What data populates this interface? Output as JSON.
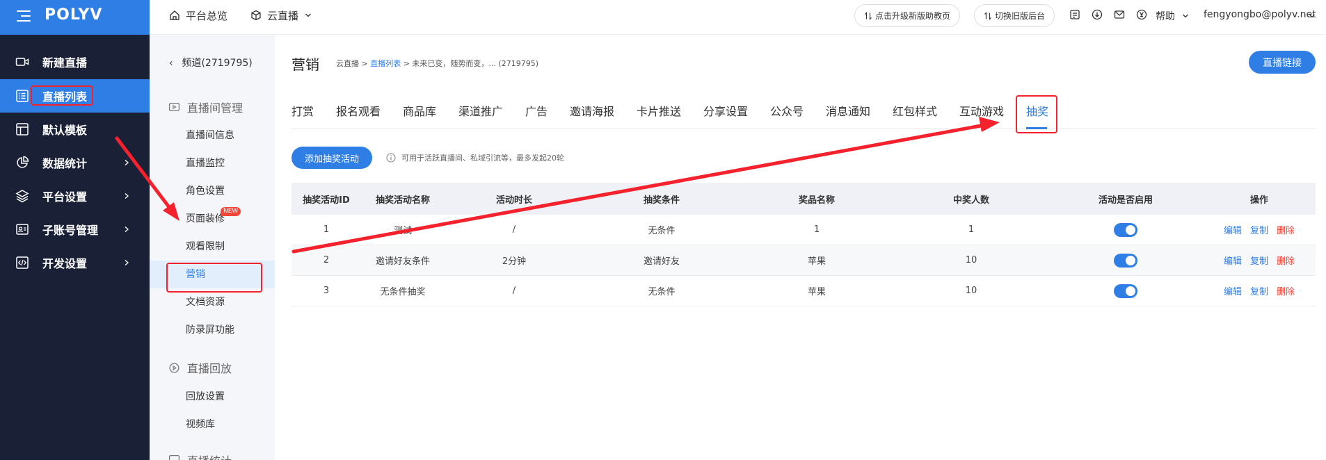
{
  "brand": {
    "logo": "POLYV",
    "accent": "#2e7ee6",
    "sidebar_bg": "#1a2036",
    "danger": "#f5463a"
  },
  "sidebar": {
    "items": [
      {
        "label": "新建直播",
        "icon": "video-camera-icon"
      },
      {
        "label": "直播列表",
        "icon": "list-icon",
        "active": true
      },
      {
        "label": "默认模板",
        "icon": "template-icon"
      },
      {
        "label": "数据统计",
        "icon": "pie-chart-icon",
        "has_children": true
      },
      {
        "label": "平台设置",
        "icon": "layers-icon",
        "has_children": true
      },
      {
        "label": "子账号管理",
        "icon": "id-card-icon",
        "has_children": true
      },
      {
        "label": "开发设置",
        "icon": "code-icon",
        "has_children": true
      }
    ]
  },
  "subnav": {
    "back_label": "频道(2719795)",
    "group1": "直播间管理",
    "items1": [
      "直播间信息",
      "直播监控",
      "角色设置",
      "页面装修",
      "观看限制",
      "营销",
      "文档资源",
      "防录屏功能"
    ],
    "new_badge": "NEW",
    "active_item": "营销",
    "group2": "直播回放",
    "items2": [
      "回放设置",
      "视频库"
    ],
    "group3": "直播统计"
  },
  "topbar": {
    "overview": "平台总览",
    "cloud_live": "云直播",
    "upgrade_btn": "点击升级新版助教页",
    "switch_btn": "切换旧版后台",
    "help": "帮助",
    "user": "fengyongbo@polyv.net"
  },
  "page": {
    "title": "营销",
    "crumb1": "云直播 >",
    "crumb2": "直播列表",
    "crumb3": "> 未来已变，随势而变，... (2719795)",
    "live_link_btn": "直播链接"
  },
  "tabs": [
    "打赏",
    "报名观看",
    "商品库",
    "渠道推广",
    "广告",
    "邀请海报",
    "卡片推送",
    "分享设置",
    "公众号",
    "消息通知",
    "红包样式",
    "互动游戏",
    "抽奖"
  ],
  "active_tab": "抽奖",
  "lottery": {
    "add_btn": "添加抽奖活动",
    "hint": "可用于活跃直播间、私域引流等，最多发起20轮",
    "columns": [
      "抽奖活动ID",
      "抽奖活动名称",
      "活动时长",
      "抽奖条件",
      "奖品名称",
      "中奖人数",
      "活动是否启用",
      "操作"
    ],
    "rows": [
      {
        "id": "1",
        "name": "测试",
        "duration": "/",
        "condition": "无条件",
        "prize": "1",
        "winners": "1",
        "enabled": true
      },
      {
        "id": "2",
        "name": "邀请好友条件",
        "duration": "2分钟",
        "condition": "邀请好友",
        "prize": "苹果",
        "winners": "10",
        "enabled": true
      },
      {
        "id": "3",
        "name": "无条件抽奖",
        "duration": "/",
        "condition": "无条件",
        "prize": "苹果",
        "winners": "10",
        "enabled": true
      }
    ],
    "ops": {
      "edit": "编辑",
      "copy": "复制",
      "delete": "删除"
    }
  }
}
